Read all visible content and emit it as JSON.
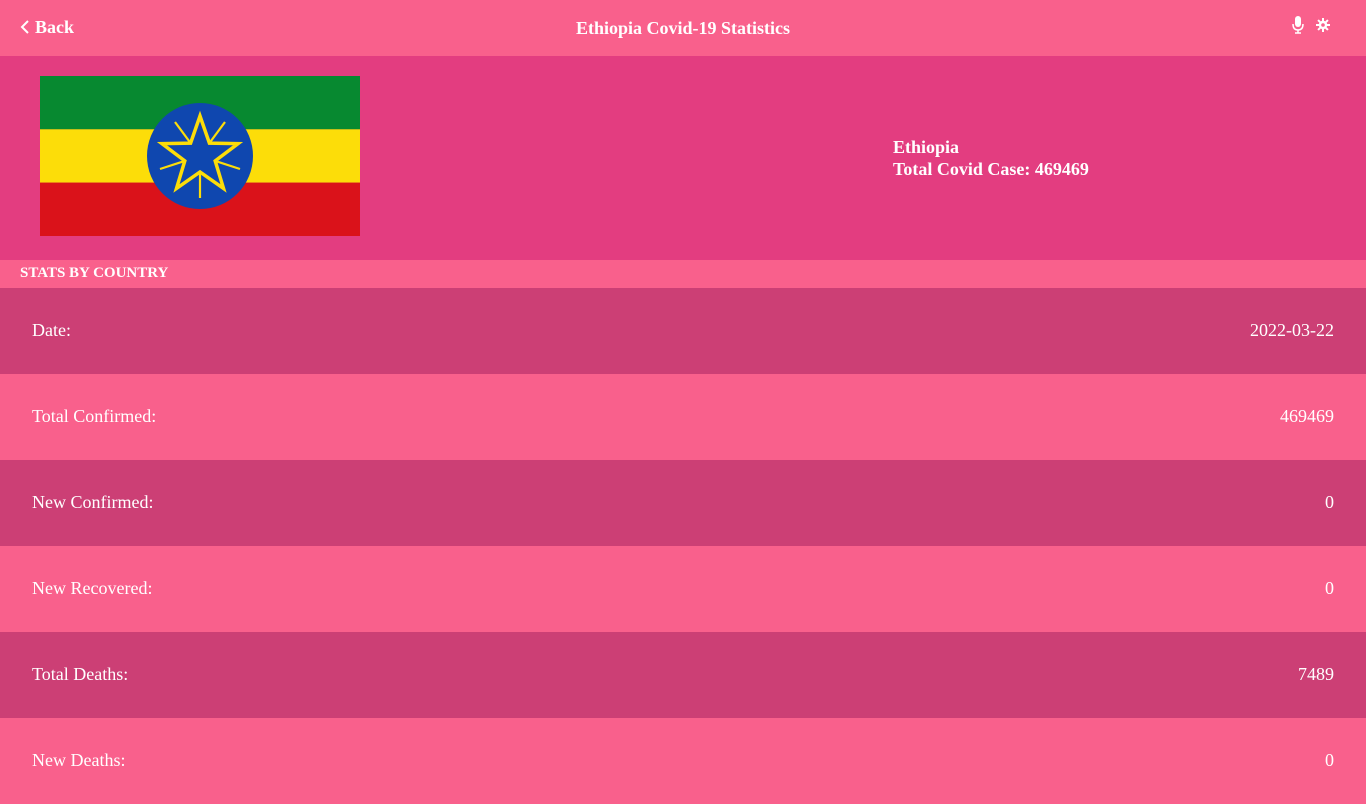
{
  "header": {
    "back_label": "Back",
    "title": "Ethiopia Covid-19 Statistics",
    "icons": [
      "microphone-icon",
      "gear-icon"
    ]
  },
  "country": {
    "name": "Ethiopia",
    "total_case_text": "Total Covid Case: 469469",
    "flag_colors": {
      "green": "#078930",
      "yellow": "#fcdd09",
      "red": "#da121a",
      "blue": "#0f47af"
    }
  },
  "section": {
    "title": "STATS BY COUNTRY"
  },
  "stats": [
    {
      "label": "Date:",
      "value": "2022-03-22"
    },
    {
      "label": "Total Confirmed:",
      "value": "469469"
    },
    {
      "label": "New Confirmed:",
      "value": "0"
    },
    {
      "label": "New Recovered:",
      "value": "0"
    },
    {
      "label": "Total Deaths:",
      "value": "7489"
    },
    {
      "label": "New Deaths:",
      "value": "0"
    }
  ],
  "colors": {
    "primary": "#f9608c",
    "hero": "#e33d80",
    "row_dark": "#cc3f75",
    "text": "#ffffff"
  }
}
